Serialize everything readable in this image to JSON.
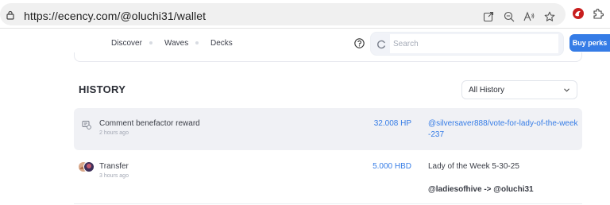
{
  "browser": {
    "url_prefix": "https://",
    "url_host": "ecency.com",
    "url_path": "/@oluchi31/wallet"
  },
  "header": {
    "nav": [
      {
        "label": "Discover"
      },
      {
        "label": "Waves"
      },
      {
        "label": "Decks"
      }
    ],
    "search_placeholder": "Search",
    "buy_label": "Buy perks"
  },
  "history": {
    "title": "HISTORY",
    "filter_value": "All History",
    "transactions": [
      {
        "type": "Comment benefactor reward",
        "time": "2 hours ago",
        "amount": "32.008 HP",
        "memo_line1": "@silversaver888/vote-for-lady-of-the-week",
        "memo_line2": "-237"
      },
      {
        "type": "Transfer",
        "time": "3 hours ago",
        "amount": "5.000 HBD",
        "memo": "Lady of the Week 5-30-25",
        "route": "@ladiesofhive -> @oluchi31"
      }
    ]
  },
  "colors": {
    "accent": "#357ce6",
    "row_highlight": "#f0f1f5"
  }
}
